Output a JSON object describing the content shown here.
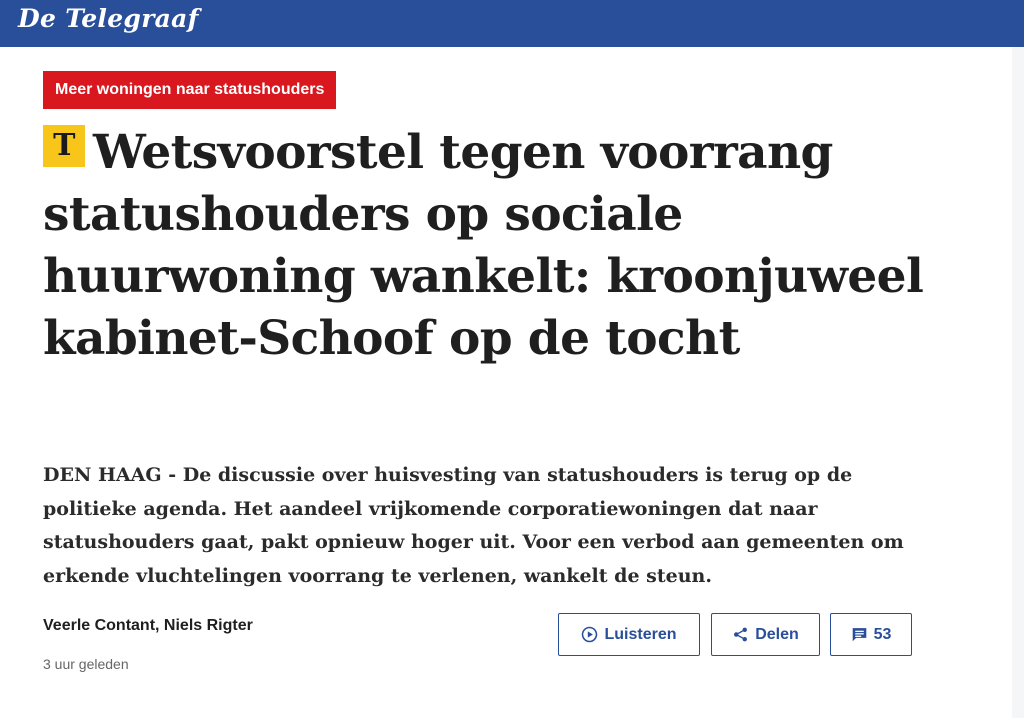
{
  "header": {
    "logo_text": "De Telegraaf",
    "background": "#2a4f9a"
  },
  "article": {
    "tag": "Meer woningen naar statushouders",
    "tag_color": "#d8171f",
    "premium_badge_letter": "T",
    "premium_badge_color": "#f8c51a",
    "headline": "Wetsvoorstel tegen voorrang statushouders op sociale huurwoning wankelt: kroonjuweel kabinet-Schoof op de tocht",
    "lead": "DEN HAAG - De discussie over huisvesting van statushouders is terug op de politieke agenda. Het aandeel vrijkomende corporatiewoningen dat naar statushouders gaat, pakt opnieuw hoger uit. Voor een verbod aan gemeenten om erkende vluchtelingen voorrang te verlenen, wankelt de steun.",
    "authors": "Veerle Contant, Niels Rigter",
    "published": "3 uur geleden"
  },
  "actions": {
    "listen": {
      "label": "Luisteren",
      "icon": "play-circle-icon"
    },
    "share": {
      "label": "Delen",
      "icon": "share-icon"
    },
    "comments": {
      "count": "53",
      "icon": "comment-icon"
    }
  }
}
